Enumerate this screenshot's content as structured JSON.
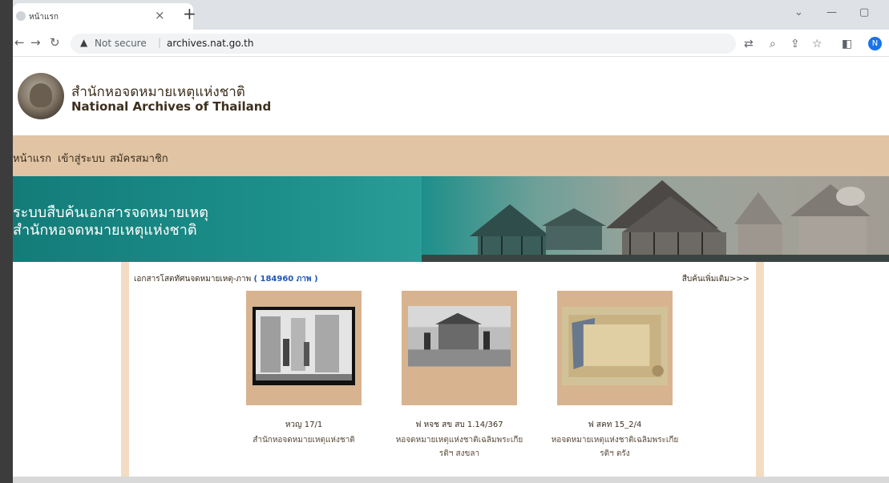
{
  "browser": {
    "tab_title": "หน้าแรก",
    "tab_close": "×",
    "new_tab": "+",
    "security_text": "Not secure",
    "url": "archives.nat.go.th",
    "profile_initial": "N"
  },
  "site": {
    "name_th": "สำนักหอจดหมายเหตุแห่งชาติ",
    "name_en": "National Archives of Thailand"
  },
  "nav": {
    "items": [
      "หน้าแรก",
      "เข้าสู่ระบบ",
      "สมัครสมาชิก"
    ]
  },
  "banner": {
    "line1": "ระบบสืบค้นเอกสารจดหมายเหตุ",
    "line2": "สำนักหอจดหมายเหตุแห่งชาติ"
  },
  "gallery": {
    "title": "เอกสารโสตทัศนจดหมายเหตุ-ภาพ",
    "count": "( 184960 ภาพ )",
    "more_link": "สืบค้นเพิ่มเติม>>>",
    "items": [
      {
        "code": "หวญ 17/1",
        "agency": "สำนักหอจดหมายเหตุแห่งชาติ",
        "agency_line2": ""
      },
      {
        "code": "ฟ หจช สข สบ 1.14/367",
        "agency": "หอจดหมายเหตุแห่งชาติเฉลิมพระเกีย",
        "agency_line2": "รติฯ สงขลา"
      },
      {
        "code": "ฟ สคท 15_2/4",
        "agency": "หอจดหมายเหตุแห่งชาติเฉลิมพระเกีย",
        "agency_line2": "รติฯ ตรัง"
      }
    ]
  },
  "colors": {
    "nav_bg": "#e0c4a4",
    "banner_teal": "#137c79",
    "card_bg": "#d7b48f",
    "link_blue": "#1f57b2"
  }
}
